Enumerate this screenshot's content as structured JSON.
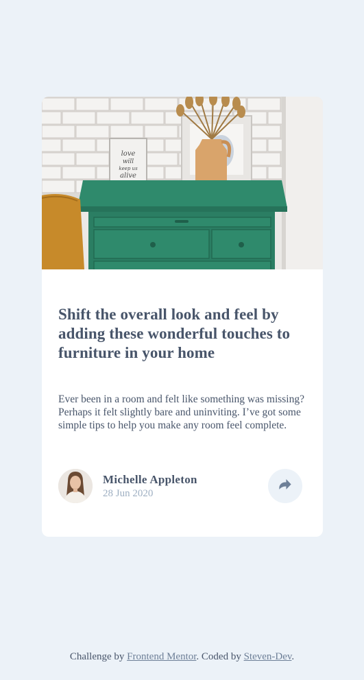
{
  "article": {
    "title": "Shift the overall look and feel by adding these wonderful touches to furniture in your home",
    "description": "Ever been in a room and felt like something was missing? Perhaps it felt slightly bare and uninviting. I’ve got some simple tips to help you make any room feel complete.",
    "image_alt": "Green drawers with a vase and framed art",
    "frame_text": "love will keep us alive"
  },
  "author": {
    "name": "Michelle Appleton",
    "date": "28 Jun 2020"
  },
  "share": {
    "icon": "share-icon"
  },
  "footer": {
    "prefix": "Challenge by ",
    "link1": "Frontend Mentor",
    "middle": ". Coded by ",
    "link2": "Steven-Dev",
    "suffix": "."
  },
  "colors": {
    "background": "#ecf2f8",
    "card": "#ffffff",
    "heading": "#48556a",
    "muted": "#9eafc2",
    "drawer_green": "#2e7c64"
  }
}
